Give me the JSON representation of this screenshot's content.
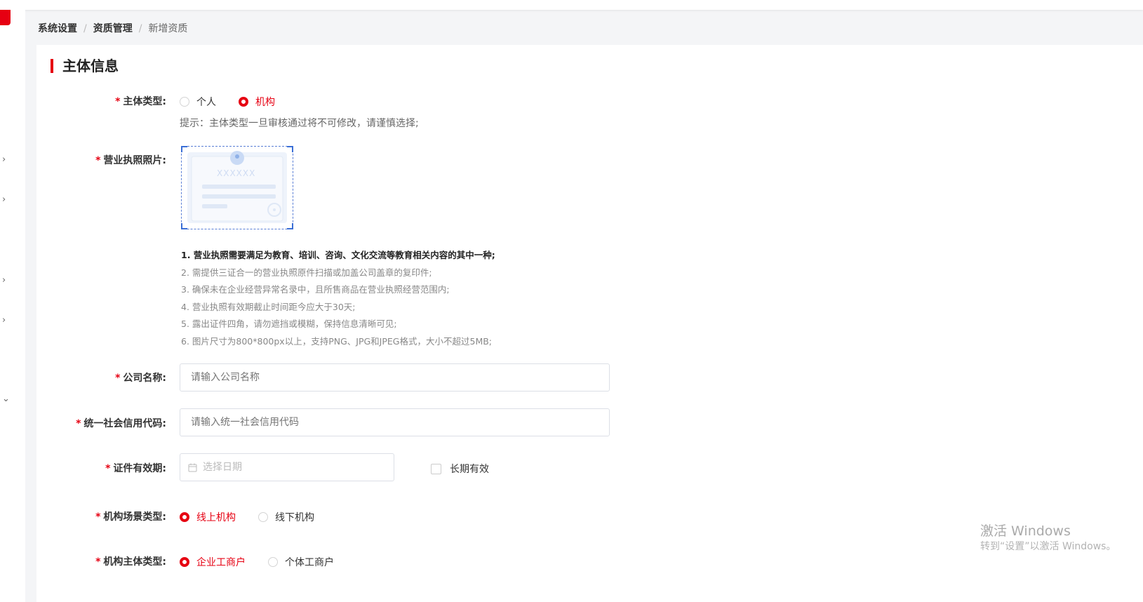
{
  "breadcrumb": {
    "items": [
      "系统设置",
      "资质管理",
      "新增资质"
    ],
    "separator": "/"
  },
  "section": {
    "title": "主体信息"
  },
  "form": {
    "required_mark": "*",
    "subject_type": {
      "label": "主体类型:",
      "options": [
        "个人",
        "机构"
      ],
      "selected": "机构",
      "hint": "提示：主体类型一旦审核通过将不可修改，请谨慎选择;"
    },
    "license_photo": {
      "label": "营业执照照片:",
      "sample_text": "XXXXXX",
      "notes": [
        "1. 营业执照需要满足为教育、培训、咨询、文化交流等教育相关内容的其中一种;",
        "2. 需提供三证合一的营业执照原件扫描或加盖公司盖章的复印件;",
        "3. 确保未在企业经营异常名录中，且所售商品在营业执照经营范围内;",
        "4. 营业执照有效期截止时间距今应大于30天;",
        "5. 露出证件四角，请勿遮挡或模糊，保持信息清晰可见;",
        "6. 图片尺寸为800*800px以上，支持PNG、JPG和JPEG格式，大小不超过5MB;"
      ]
    },
    "company_name": {
      "label": "公司名称:",
      "placeholder": "请输入公司名称",
      "value": ""
    },
    "credit_code": {
      "label": "统一社会信用代码:",
      "placeholder": "请输入统一社会信用代码",
      "value": ""
    },
    "validity": {
      "label": "证件有效期:",
      "placeholder": "选择日期",
      "long_term_label": "长期有效",
      "long_term_checked": false
    },
    "scene_type": {
      "label": "机构场景类型:",
      "options": [
        "线上机构",
        "线下机构"
      ],
      "selected": "线上机构"
    },
    "entity_type": {
      "label": "机构主体类型:",
      "options": [
        "企业工商户",
        "个体工商户"
      ],
      "selected": "企业工商户"
    }
  },
  "watermark": {
    "title": "激活 Windows",
    "subtitle": "转到“设置”以激活 Windows。"
  },
  "colors": {
    "accent": "#e60012",
    "upload_border": "#5a7fd6",
    "background": "#f4f5f7"
  },
  "icons": {
    "calendar": "calendar-icon",
    "chevron": "chevron-right-icon"
  }
}
